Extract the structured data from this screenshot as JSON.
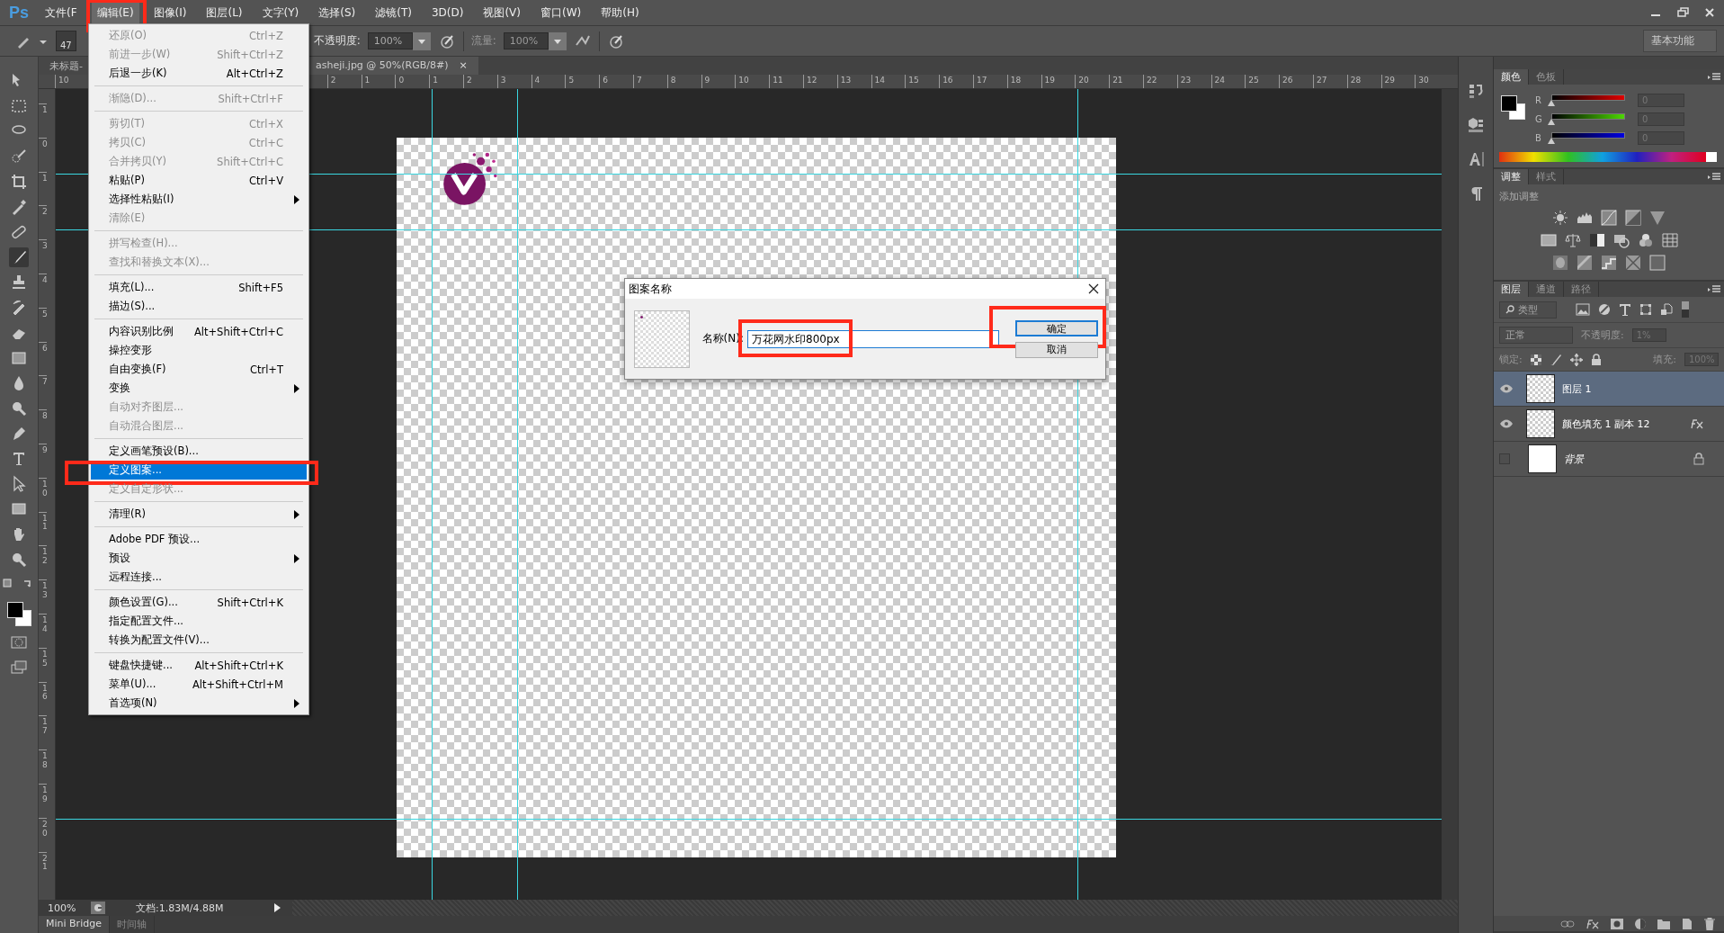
{
  "app": {
    "logo": "Ps"
  },
  "menu_bar": [
    {
      "label": "文件(F",
      "selected": false,
      "annotated": false
    },
    {
      "label": "编辑(E)",
      "selected": true,
      "annotated": true
    },
    {
      "label": "图像(I)",
      "selected": false,
      "annotated": false
    },
    {
      "label": "图层(L)",
      "selected": false,
      "annotated": false
    },
    {
      "label": "文字(Y)",
      "selected": false,
      "annotated": false
    },
    {
      "label": "选择(S)",
      "selected": false,
      "annotated": false
    },
    {
      "label": "滤镜(T)",
      "selected": false,
      "annotated": false
    },
    {
      "label": "3D(D)",
      "selected": false,
      "annotated": false
    },
    {
      "label": "视图(V)",
      "selected": false,
      "annotated": false
    },
    {
      "label": "窗口(W)",
      "selected": false,
      "annotated": false
    },
    {
      "label": "帮助(H)",
      "selected": false,
      "annotated": false
    }
  ],
  "options_bar": {
    "brush_size": "47",
    "opacity_label": "不透明度:",
    "opacity": "100%",
    "flow_label": "流量:",
    "flow": "100%",
    "workspace": "基本功能"
  },
  "document_tabs": [
    {
      "label": "未标题-",
      "selected": false
    },
    {
      "label": "asheji.jpg @ 50%(RGB/8#)",
      "selected": true,
      "close": "×"
    }
  ],
  "rulers": {
    "horizontal_first": "10",
    "horizontal": [
      "2",
      "1",
      "0",
      "1",
      "2",
      "3",
      "4",
      "5",
      "6",
      "7",
      "8",
      "9",
      "10",
      "11",
      "12",
      "13",
      "14",
      "15",
      "16",
      "17",
      "18",
      "19",
      "20",
      "21",
      "22",
      "23",
      "24",
      "25",
      "26",
      "27",
      "28",
      "29",
      "30"
    ],
    "vertical": [
      "1",
      "0",
      "1",
      "2",
      "3",
      "4",
      "5",
      "6",
      "7",
      "8",
      "9",
      "10",
      "11",
      "12",
      "13",
      "14",
      "15",
      "16",
      "17",
      "18",
      "19",
      "20",
      "21"
    ]
  },
  "edit_menu": {
    "groups": [
      [
        {
          "label": "还原(O)",
          "shortcut": "Ctrl+Z",
          "disabled": true,
          "submenu": false,
          "selected": false,
          "annotated": false
        },
        {
          "label": "前进一步(W)",
          "shortcut": "Shift+Ctrl+Z",
          "disabled": true,
          "submenu": false,
          "selected": false,
          "annotated": false
        },
        {
          "label": "后退一步(K)",
          "shortcut": "Alt+Ctrl+Z",
          "disabled": false,
          "submenu": false,
          "selected": false,
          "annotated": false
        }
      ],
      [
        {
          "label": "渐隐(D)...",
          "shortcut": "Shift+Ctrl+F",
          "disabled": true,
          "submenu": false,
          "selected": false,
          "annotated": false
        }
      ],
      [
        {
          "label": "剪切(T)",
          "shortcut": "Ctrl+X",
          "disabled": true,
          "submenu": false,
          "selected": false,
          "annotated": false
        },
        {
          "label": "拷贝(C)",
          "shortcut": "Ctrl+C",
          "disabled": true,
          "submenu": false,
          "selected": false,
          "annotated": false
        },
        {
          "label": "合并拷贝(Y)",
          "shortcut": "Shift+Ctrl+C",
          "disabled": true,
          "submenu": false,
          "selected": false,
          "annotated": false
        },
        {
          "label": "粘贴(P)",
          "shortcut": "Ctrl+V",
          "disabled": false,
          "submenu": false,
          "selected": false,
          "annotated": false
        },
        {
          "label": "选择性粘贴(I)",
          "disabled": false,
          "submenu": true,
          "selected": false,
          "annotated": false
        },
        {
          "label": "清除(E)",
          "disabled": true,
          "submenu": false,
          "selected": false,
          "annotated": false
        }
      ],
      [
        {
          "label": "拼写检查(H)...",
          "disabled": true,
          "submenu": false,
          "selected": false,
          "annotated": false
        },
        {
          "label": "查找和替换文本(X)...",
          "disabled": true,
          "submenu": false,
          "selected": false,
          "annotated": false
        }
      ],
      [
        {
          "label": "填充(L)...",
          "shortcut": "Shift+F5",
          "disabled": false,
          "submenu": false,
          "selected": false,
          "annotated": false
        },
        {
          "label": "描边(S)...",
          "disabled": false,
          "submenu": false,
          "selected": false,
          "annotated": false
        }
      ],
      [
        {
          "label": "内容识别比例",
          "shortcut": "Alt+Shift+Ctrl+C",
          "disabled": false,
          "submenu": false,
          "selected": false,
          "annotated": false
        },
        {
          "label": "操控变形",
          "disabled": false,
          "submenu": false,
          "selected": false,
          "annotated": false
        },
        {
          "label": "自由变换(F)",
          "shortcut": "Ctrl+T",
          "disabled": false,
          "submenu": false,
          "selected": false,
          "annotated": false
        },
        {
          "label": "变换",
          "disabled": false,
          "submenu": true,
          "selected": false,
          "annotated": false
        },
        {
          "label": "自动对齐图层...",
          "disabled": true,
          "submenu": false,
          "selected": false,
          "annotated": false
        },
        {
          "label": "自动混合图层...",
          "disabled": true,
          "submenu": false,
          "selected": false,
          "annotated": false
        }
      ],
      [
        {
          "label": "定义画笔预设(B)...",
          "disabled": false,
          "submenu": false,
          "selected": false,
          "annotated": false
        },
        {
          "label": "定义图案...",
          "disabled": false,
          "submenu": false,
          "selected": true,
          "annotated": true
        },
        {
          "label": "定义自定形状...",
          "disabled": true,
          "submenu": false,
          "selected": false,
          "annotated": false
        }
      ],
      [
        {
          "label": "清理(R)",
          "disabled": false,
          "submenu": true,
          "selected": false,
          "annotated": false
        }
      ],
      [
        {
          "label": "Adobe PDF 预设...",
          "disabled": false,
          "submenu": false,
          "selected": false,
          "annotated": false
        },
        {
          "label": "预设",
          "disabled": false,
          "submenu": true,
          "selected": false,
          "annotated": false
        },
        {
          "label": "远程连接...",
          "disabled": false,
          "submenu": false,
          "selected": false,
          "annotated": false
        }
      ],
      [
        {
          "label": "颜色设置(G)...",
          "shortcut": "Shift+Ctrl+K",
          "disabled": false,
          "submenu": false,
          "selected": false,
          "annotated": false
        },
        {
          "label": "指定配置文件...",
          "disabled": false,
          "submenu": false,
          "selected": false,
          "annotated": false
        },
        {
          "label": "转换为配置文件(V)...",
          "disabled": false,
          "submenu": false,
          "selected": false,
          "annotated": false
        }
      ],
      [
        {
          "label": "键盘快捷键...",
          "shortcut": "Alt+Shift+Ctrl+K",
          "disabled": false,
          "submenu": false,
          "selected": false,
          "annotated": false
        },
        {
          "label": "菜单(U)...",
          "shortcut": "Alt+Shift+Ctrl+M",
          "disabled": false,
          "submenu": false,
          "selected": false,
          "annotated": false
        },
        {
          "label": "首选项(N)",
          "disabled": false,
          "submenu": true,
          "selected": false,
          "annotated": false
        }
      ]
    ]
  },
  "dialog": {
    "title": "图案名称",
    "name_label": "名称(N):",
    "name_value": "万花网水印800px",
    "field_annotated": true,
    "buttons": [
      {
        "label": "确定",
        "default": true,
        "annotated": true
      },
      {
        "label": "取消",
        "default": false,
        "annotated": false
      }
    ]
  },
  "status_bar": {
    "zoom": "100%",
    "doc_info": "文档:1.83M/4.88M"
  },
  "bottom_tabs": [
    {
      "label": "Mini Bridge",
      "selected": true
    },
    {
      "label": "时间轴",
      "selected": false
    }
  ],
  "color_panel": {
    "tabs": [
      {
        "label": "颜色",
        "selected": true
      },
      {
        "label": "色板",
        "selected": false
      }
    ],
    "channels": [
      {
        "label": "R",
        "value": "0",
        "level": 0
      },
      {
        "label": "G",
        "value": "0",
        "level": 0
      },
      {
        "label": "B",
        "value": "0",
        "level": 0
      }
    ]
  },
  "adjustments_panel": {
    "tabs": [
      {
        "label": "调整",
        "selected": true
      },
      {
        "label": "样式",
        "selected": false
      }
    ],
    "hint": "添加调整"
  },
  "layers_panel": {
    "tabs": [
      {
        "label": "图层",
        "selected": true
      },
      {
        "label": "通道",
        "selected": false
      },
      {
        "label": "路径",
        "selected": false
      }
    ],
    "filter": "类型",
    "blend_mode": "正常",
    "opacity_label": "不透明度:",
    "opacity": "1%",
    "lock_label": "锁定:",
    "fill_label": "填充:",
    "fill": "100%",
    "layers": [
      {
        "name": "图层 1",
        "visible": true,
        "selected": true,
        "locked": false,
        "effects": false,
        "italic": false,
        "kind": "transparent"
      },
      {
        "name": "颜色填充 1 副本 12",
        "visible": true,
        "selected": false,
        "locked": false,
        "effects": true,
        "italic": false,
        "kind": "transparent"
      },
      {
        "name": "背景",
        "visible": false,
        "selected": false,
        "locked": true,
        "effects": false,
        "italic": true,
        "kind": "white"
      }
    ]
  }
}
